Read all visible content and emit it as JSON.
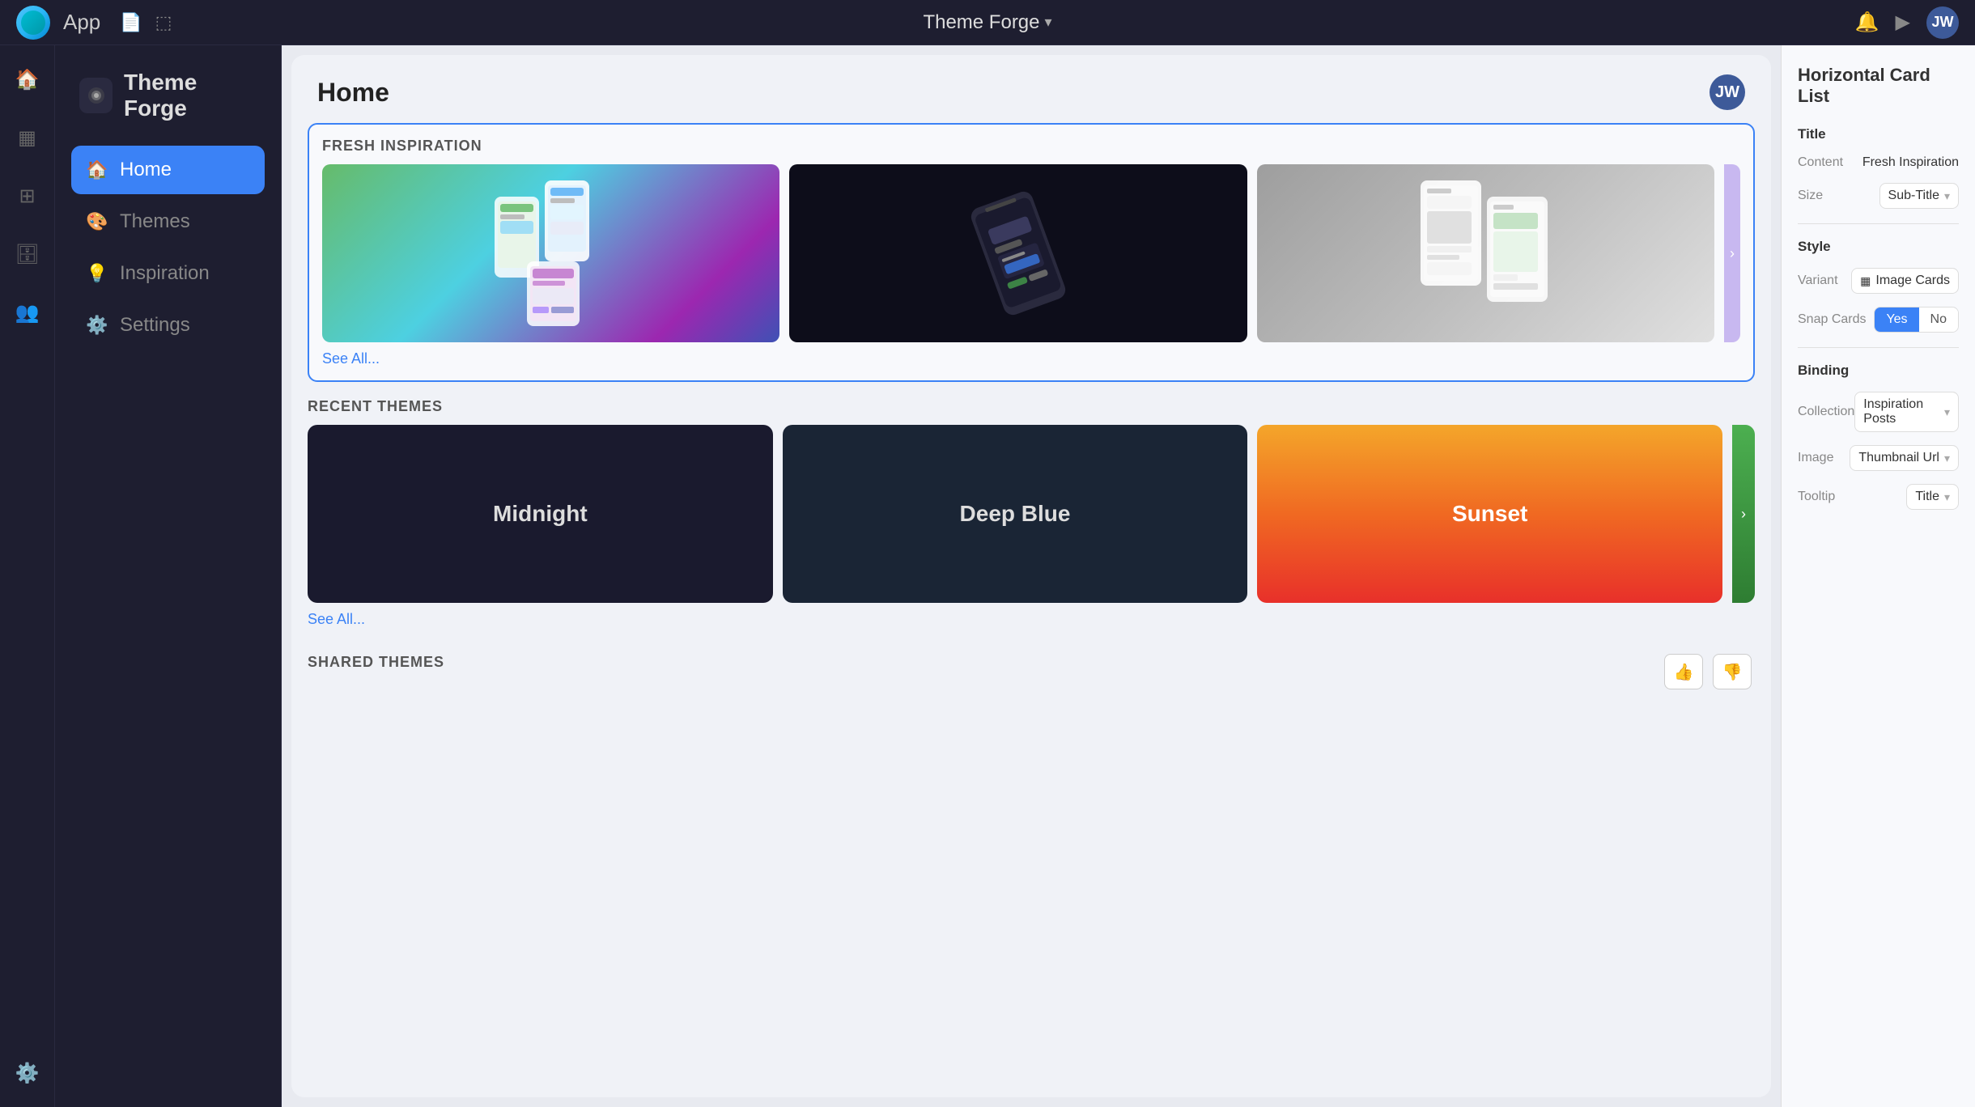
{
  "topbar": {
    "app_label": "App",
    "title": "Theme Forge",
    "title_short": "Theme Forge",
    "avatar_initials": "JW",
    "chevron": "▾"
  },
  "left_nav": {
    "app_name": "Theme Forge",
    "items": [
      {
        "id": "home",
        "label": "Home",
        "icon": "🏠",
        "active": true
      },
      {
        "id": "themes",
        "label": "Themes",
        "icon": "🎨",
        "active": false
      },
      {
        "id": "inspiration",
        "label": "Inspiration",
        "icon": "💡",
        "active": false
      },
      {
        "id": "settings",
        "label": "Settings",
        "icon": "⚙️",
        "active": false
      }
    ],
    "bottom_icon": "⚙️"
  },
  "page": {
    "title": "Home",
    "avatar_initials": "JW"
  },
  "fresh_inspiration": {
    "section_label": "FRESH INSPIRATION",
    "see_all": "See All...",
    "cards": [
      {
        "id": "card-1",
        "alt": "App UI screenshot 1"
      },
      {
        "id": "card-2",
        "alt": "Phone mockup"
      },
      {
        "id": "card-3",
        "alt": "Finance app"
      }
    ]
  },
  "recent_themes": {
    "section_label": "RECENT THEMES",
    "see_all": "See All...",
    "themes": [
      {
        "id": "midnight",
        "label": "Midnight"
      },
      {
        "id": "deepblue",
        "label": "Deep Blue"
      },
      {
        "id": "sunset",
        "label": "Sunset"
      }
    ]
  },
  "shared_themes": {
    "section_label": "SHARED THEMES",
    "thumbs_up": "👍",
    "thumbs_down": "👎"
  },
  "right_panel": {
    "title": "Horizontal Card List",
    "title_section": "Title",
    "content_label": "Content",
    "content_value": "Fresh Inspiration",
    "size_label": "Size",
    "size_value": "Sub-Title",
    "style_section": "Style",
    "variant_label": "Variant",
    "variant_value": "Image Cards",
    "snap_cards_label": "Snap Cards",
    "snap_yes": "Yes",
    "snap_no": "No",
    "binding_section": "Binding",
    "collection_label": "Collection",
    "collection_value": "Inspiration Posts",
    "image_label": "Image",
    "image_value": "Thumbnail Url",
    "tooltip_label": "Tooltip",
    "tooltip_value": "Title"
  }
}
